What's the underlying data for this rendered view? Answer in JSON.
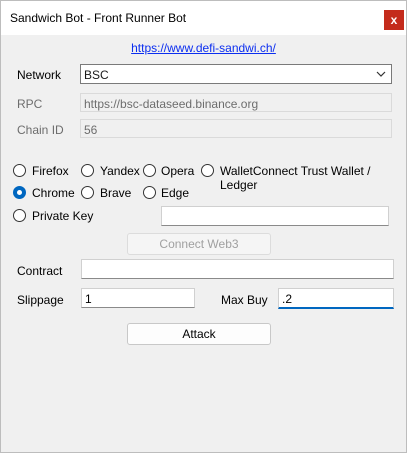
{
  "window": {
    "title": "Sandwich Bot - Front Runner Bot",
    "close_glyph": "x"
  },
  "link": "https://www.defi-sandwi.ch/",
  "network": {
    "label": "Network",
    "value": "BSC"
  },
  "rpc": {
    "label": "RPC",
    "value": "https://bsc-dataseed.binance.org"
  },
  "chain_id": {
    "label": "Chain ID",
    "value": "56"
  },
  "wallets": {
    "firefox": "Firefox",
    "yandex": "Yandex",
    "opera": "Opera",
    "walletconnect": "WalletConnect Trust Wallet / Ledger",
    "chrome": "Chrome",
    "brave": "Brave",
    "edge": "Edge",
    "private_key": "Private Key",
    "selected": "chrome"
  },
  "private_key_value": "",
  "connect_button": "Connect Web3",
  "contract": {
    "label": "Contract",
    "value": ""
  },
  "slippage": {
    "label": "Slippage",
    "value": "1"
  },
  "max_buy": {
    "label": "Max Buy",
    "value": ".2"
  },
  "attack_button": "Attack",
  "accent_color": "#0067c0",
  "close_color": "#c42b1c"
}
